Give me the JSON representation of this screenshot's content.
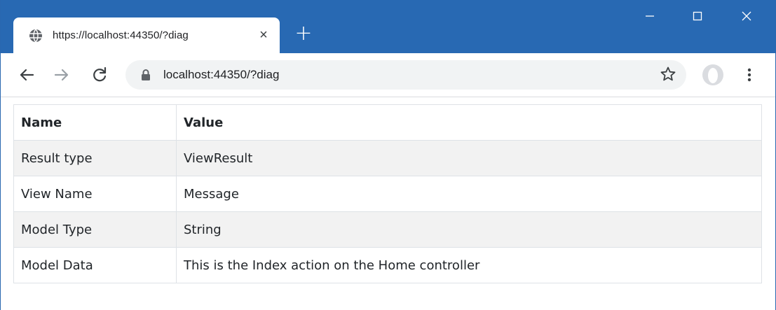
{
  "browser": {
    "tab": {
      "title": "https://localhost:44350/?diag",
      "close_glyph": "×",
      "icon": "globe-icon"
    },
    "new_tab_glyph": "+",
    "window_controls": [
      "minimize-icon",
      "maximize-icon",
      "close-icon"
    ],
    "address": {
      "value": "localhost:44350/?diag",
      "icon": "lock-icon"
    },
    "toolbar_icons": [
      "back-arrow-icon",
      "forward-arrow-icon",
      "reload-icon",
      "star-icon",
      "profile-avatar-icon",
      "kebab-menu-icon"
    ],
    "colors": {
      "titlebar": "#2869b3",
      "omnibox": "#f1f3f4",
      "striped_row": "#f2f2f2"
    }
  },
  "table": {
    "headers": [
      "Name",
      "Value"
    ],
    "rows": [
      [
        "Result type",
        "ViewResult"
      ],
      [
        "View Name",
        "Message"
      ],
      [
        "Model Type",
        "String"
      ],
      [
        "Model Data",
        "This is the Index action on the Home controller"
      ]
    ]
  }
}
